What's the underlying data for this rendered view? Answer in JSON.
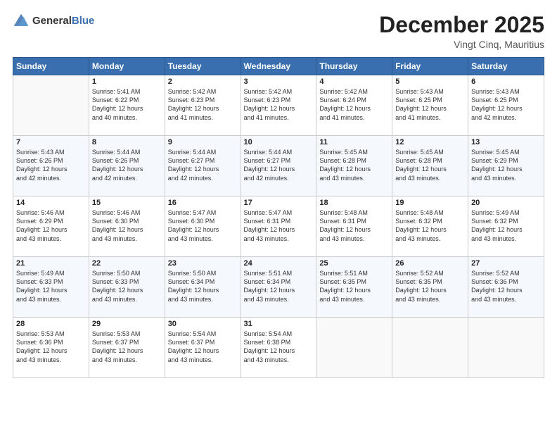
{
  "header": {
    "logo_general": "General",
    "logo_blue": "Blue",
    "month": "December 2025",
    "location": "Vingt Cinq, Mauritius"
  },
  "days_of_week": [
    "Sunday",
    "Monday",
    "Tuesday",
    "Wednesday",
    "Thursday",
    "Friday",
    "Saturday"
  ],
  "weeks": [
    [
      {
        "day": "",
        "info": ""
      },
      {
        "day": "1",
        "info": "Sunrise: 5:41 AM\nSunset: 6:22 PM\nDaylight: 12 hours\nand 40 minutes."
      },
      {
        "day": "2",
        "info": "Sunrise: 5:42 AM\nSunset: 6:23 PM\nDaylight: 12 hours\nand 41 minutes."
      },
      {
        "day": "3",
        "info": "Sunrise: 5:42 AM\nSunset: 6:23 PM\nDaylight: 12 hours\nand 41 minutes."
      },
      {
        "day": "4",
        "info": "Sunrise: 5:42 AM\nSunset: 6:24 PM\nDaylight: 12 hours\nand 41 minutes."
      },
      {
        "day": "5",
        "info": "Sunrise: 5:43 AM\nSunset: 6:25 PM\nDaylight: 12 hours\nand 41 minutes."
      },
      {
        "day": "6",
        "info": "Sunrise: 5:43 AM\nSunset: 6:25 PM\nDaylight: 12 hours\nand 42 minutes."
      }
    ],
    [
      {
        "day": "7",
        "info": "Sunrise: 5:43 AM\nSunset: 6:26 PM\nDaylight: 12 hours\nand 42 minutes."
      },
      {
        "day": "8",
        "info": "Sunrise: 5:44 AM\nSunset: 6:26 PM\nDaylight: 12 hours\nand 42 minutes."
      },
      {
        "day": "9",
        "info": "Sunrise: 5:44 AM\nSunset: 6:27 PM\nDaylight: 12 hours\nand 42 minutes."
      },
      {
        "day": "10",
        "info": "Sunrise: 5:44 AM\nSunset: 6:27 PM\nDaylight: 12 hours\nand 42 minutes."
      },
      {
        "day": "11",
        "info": "Sunrise: 5:45 AM\nSunset: 6:28 PM\nDaylight: 12 hours\nand 43 minutes."
      },
      {
        "day": "12",
        "info": "Sunrise: 5:45 AM\nSunset: 6:28 PM\nDaylight: 12 hours\nand 43 minutes."
      },
      {
        "day": "13",
        "info": "Sunrise: 5:45 AM\nSunset: 6:29 PM\nDaylight: 12 hours\nand 43 minutes."
      }
    ],
    [
      {
        "day": "14",
        "info": "Sunrise: 5:46 AM\nSunset: 6:29 PM\nDaylight: 12 hours\nand 43 minutes."
      },
      {
        "day": "15",
        "info": "Sunrise: 5:46 AM\nSunset: 6:30 PM\nDaylight: 12 hours\nand 43 minutes."
      },
      {
        "day": "16",
        "info": "Sunrise: 5:47 AM\nSunset: 6:30 PM\nDaylight: 12 hours\nand 43 minutes."
      },
      {
        "day": "17",
        "info": "Sunrise: 5:47 AM\nSunset: 6:31 PM\nDaylight: 12 hours\nand 43 minutes."
      },
      {
        "day": "18",
        "info": "Sunrise: 5:48 AM\nSunset: 6:31 PM\nDaylight: 12 hours\nand 43 minutes."
      },
      {
        "day": "19",
        "info": "Sunrise: 5:48 AM\nSunset: 6:32 PM\nDaylight: 12 hours\nand 43 minutes."
      },
      {
        "day": "20",
        "info": "Sunrise: 5:49 AM\nSunset: 6:32 PM\nDaylight: 12 hours\nand 43 minutes."
      }
    ],
    [
      {
        "day": "21",
        "info": "Sunrise: 5:49 AM\nSunset: 6:33 PM\nDaylight: 12 hours\nand 43 minutes."
      },
      {
        "day": "22",
        "info": "Sunrise: 5:50 AM\nSunset: 6:33 PM\nDaylight: 12 hours\nand 43 minutes."
      },
      {
        "day": "23",
        "info": "Sunrise: 5:50 AM\nSunset: 6:34 PM\nDaylight: 12 hours\nand 43 minutes."
      },
      {
        "day": "24",
        "info": "Sunrise: 5:51 AM\nSunset: 6:34 PM\nDaylight: 12 hours\nand 43 minutes."
      },
      {
        "day": "25",
        "info": "Sunrise: 5:51 AM\nSunset: 6:35 PM\nDaylight: 12 hours\nand 43 minutes."
      },
      {
        "day": "26",
        "info": "Sunrise: 5:52 AM\nSunset: 6:35 PM\nDaylight: 12 hours\nand 43 minutes."
      },
      {
        "day": "27",
        "info": "Sunrise: 5:52 AM\nSunset: 6:36 PM\nDaylight: 12 hours\nand 43 minutes."
      }
    ],
    [
      {
        "day": "28",
        "info": "Sunrise: 5:53 AM\nSunset: 6:36 PM\nDaylight: 12 hours\nand 43 minutes."
      },
      {
        "day": "29",
        "info": "Sunrise: 5:53 AM\nSunset: 6:37 PM\nDaylight: 12 hours\nand 43 minutes."
      },
      {
        "day": "30",
        "info": "Sunrise: 5:54 AM\nSunset: 6:37 PM\nDaylight: 12 hours\nand 43 minutes."
      },
      {
        "day": "31",
        "info": "Sunrise: 5:54 AM\nSunset: 6:38 PM\nDaylight: 12 hours\nand 43 minutes."
      },
      {
        "day": "",
        "info": ""
      },
      {
        "day": "",
        "info": ""
      },
      {
        "day": "",
        "info": ""
      }
    ]
  ]
}
